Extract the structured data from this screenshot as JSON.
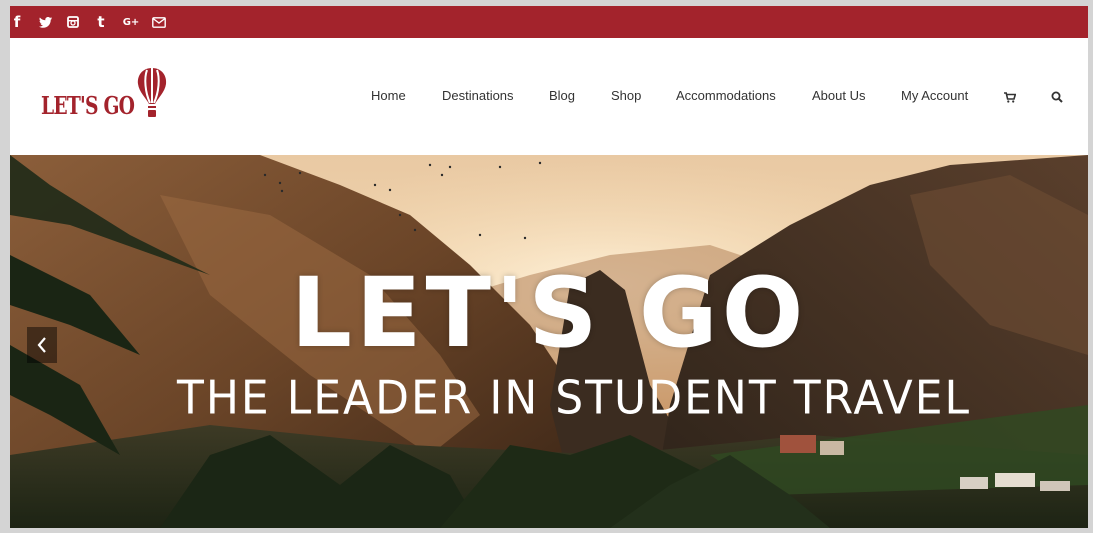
{
  "social": {
    "icons": [
      {
        "name": "facebook-icon",
        "glyph": "f"
      },
      {
        "name": "twitter-icon",
        "glyph": "🐦"
      },
      {
        "name": "instagram-icon",
        "glyph": "◫"
      },
      {
        "name": "tumblr-icon",
        "glyph": "t"
      },
      {
        "name": "google-plus-icon",
        "glyph": "G+"
      },
      {
        "name": "email-icon",
        "glyph": "✉"
      }
    ]
  },
  "logo": {
    "text": "LET'S GO"
  },
  "nav": {
    "items": [
      "Home",
      "Destinations",
      "Blog",
      "Shop",
      "Accommodations",
      "About Us",
      "My Account"
    ],
    "cart_icon": "cart-icon",
    "search_icon": "search-icon"
  },
  "hero": {
    "title": "LET'S GO",
    "subtitle": "THE LEADER IN STUDENT TRAVEL",
    "prev_glyph": "‹"
  },
  "colors": {
    "brand": "#a3232c",
    "nav_text": "#333333"
  }
}
